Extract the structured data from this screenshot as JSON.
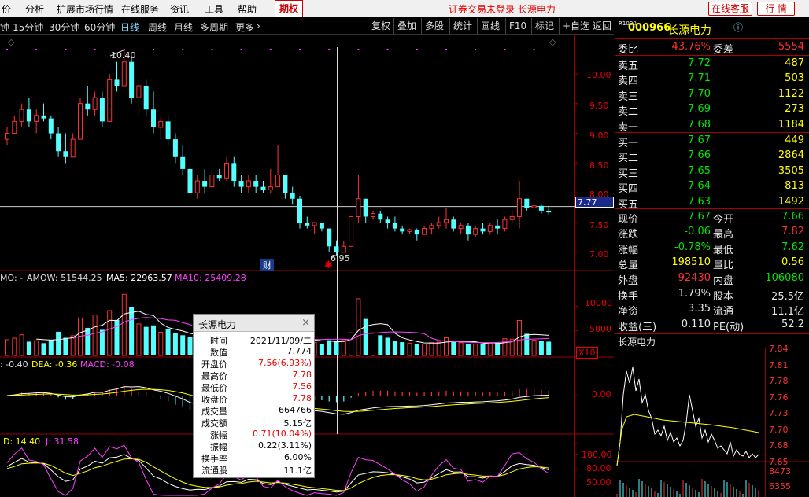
{
  "menubar": {
    "items": [
      "价",
      "分析",
      "扩展市场行情",
      "在线服务",
      "资讯",
      "工具",
      "帮助"
    ],
    "qq": "期权",
    "title": "证券交易未登录  长源电力",
    "btn_kefu": "在线客服",
    "btn_hangqing": "行 情"
  },
  "periods": [
    "钟",
    "15分钟",
    "30分钟",
    "60分钟",
    "日线",
    "周线",
    "月线",
    "多周期",
    "更多"
  ],
  "active_period": "日线",
  "toolbar": [
    "复权",
    "叠加",
    "多股",
    "统计",
    "画线",
    "F10",
    "标记",
    "+自选",
    "返回"
  ],
  "price_axis": [
    "10.00",
    "9.50",
    "9.00",
    "8.50",
    "8.00",
    "7.50",
    "7.00"
  ],
  "last_price_tag": "7.77",
  "high_mark": "10.40",
  "low_mark": "6.95",
  "cai_marker": "财",
  "vol_header": {
    "prefix": "MO: -",
    "amow_label": "AMOW: 51544.25",
    "ma5_label": "MA5: 22963.57",
    "ma10_label": "MA10: 25409.28"
  },
  "vol_axis": [
    "10000",
    "5000"
  ],
  "vol_multiplier": "X10",
  "macd_header": {
    "diff": ": -0.40",
    "dea": "DEA: -0.36",
    "macd": "MACD: -0.08"
  },
  "macd_axis": [
    "0.00"
  ],
  "kdj_header": {
    "d": "D: 14.40",
    "j": "J: 31.58"
  },
  "kdj_axis": [
    "100.00",
    "80.00",
    "50.00"
  ],
  "chart_data": {
    "type": "candlestick",
    "ylim": [
      6.8,
      10.5
    ],
    "vlim": [
      0,
      15000
    ],
    "ohlc": [
      [
        8.9,
        9.1,
        8.8,
        9.0
      ],
      [
        9.0,
        9.3,
        9.0,
        9.2
      ],
      [
        9.2,
        9.5,
        9.1,
        9.4
      ],
      [
        9.4,
        9.6,
        9.1,
        9.2
      ],
      [
        9.2,
        9.4,
        9.0,
        9.3
      ],
      [
        9.3,
        9.5,
        9.2,
        9.25
      ],
      [
        9.25,
        9.3,
        8.9,
        9.0
      ],
      [
        9.0,
        9.1,
        8.6,
        8.7
      ],
      [
        8.7,
        9.0,
        8.5,
        8.6
      ],
      [
        8.6,
        9.0,
        8.6,
        8.9
      ],
      [
        8.9,
        9.6,
        8.9,
        9.5
      ],
      [
        9.5,
        9.8,
        9.3,
        9.4
      ],
      [
        9.4,
        9.7,
        9.3,
        9.6
      ],
      [
        9.6,
        9.7,
        9.1,
        9.2
      ],
      [
        9.2,
        10.0,
        9.2,
        9.9
      ],
      [
        9.9,
        10.2,
        9.7,
        9.8
      ],
      [
        9.8,
        10.4,
        9.8,
        10.2
      ],
      [
        10.2,
        10.3,
        9.5,
        9.6
      ],
      [
        9.6,
        9.9,
        9.3,
        9.8
      ],
      [
        9.8,
        9.9,
        9.3,
        9.4
      ],
      [
        9.4,
        9.7,
        9.0,
        9.1
      ],
      [
        9.1,
        9.3,
        8.9,
        9.2
      ],
      [
        9.2,
        9.3,
        8.8,
        8.9
      ],
      [
        8.9,
        9.0,
        8.5,
        8.6
      ],
      [
        8.6,
        8.8,
        8.3,
        8.4
      ],
      [
        8.4,
        8.5,
        7.9,
        8.0
      ],
      [
        8.0,
        8.3,
        7.9,
        8.2
      ],
      [
        8.2,
        8.4,
        8.0,
        8.1
      ],
      [
        8.1,
        8.4,
        8.1,
        8.3
      ],
      [
        8.3,
        8.4,
        8.2,
        8.25
      ],
      [
        8.25,
        8.6,
        8.2,
        8.5
      ],
      [
        8.5,
        8.6,
        8.1,
        8.2
      ],
      [
        8.2,
        8.3,
        8.0,
        8.1
      ],
      [
        8.1,
        8.3,
        8.0,
        8.2
      ],
      [
        8.2,
        8.3,
        8.0,
        8.1
      ],
      [
        8.1,
        8.2,
        8.0,
        8.05
      ],
      [
        8.05,
        8.4,
        8.0,
        8.1
      ],
      [
        8.1,
        8.8,
        8.1,
        8.3
      ],
      [
        8.3,
        8.3,
        7.9,
        8.0
      ],
      [
        8.0,
        8.1,
        7.8,
        7.9
      ],
      [
        7.9,
        7.95,
        7.4,
        7.5
      ],
      [
        7.5,
        7.6,
        7.4,
        7.45
      ],
      [
        7.45,
        7.5,
        7.3,
        7.5
      ],
      [
        7.5,
        7.5,
        7.35,
        7.4
      ],
      [
        7.4,
        7.4,
        7.0,
        7.1
      ],
      [
        7.1,
        7.2,
        6.95,
        7.0
      ],
      [
        7.0,
        7.2,
        7.0,
        7.1
      ],
      [
        7.1,
        7.6,
        7.1,
        7.6
      ],
      [
        7.6,
        8.3,
        7.5,
        7.9
      ],
      [
        7.9,
        7.9,
        7.5,
        7.6
      ],
      [
        7.6,
        7.7,
        7.55,
        7.65
      ],
      [
        7.65,
        7.7,
        7.5,
        7.55
      ],
      [
        7.55,
        7.6,
        7.4,
        7.5
      ],
      [
        7.5,
        7.6,
        7.35,
        7.4
      ],
      [
        7.4,
        7.45,
        7.3,
        7.35
      ],
      [
        7.35,
        7.4,
        7.3,
        7.38
      ],
      [
        7.38,
        7.4,
        7.2,
        7.3
      ],
      [
        7.3,
        7.45,
        7.3,
        7.4
      ],
      [
        7.4,
        7.5,
        7.3,
        7.45
      ],
      [
        7.45,
        7.6,
        7.4,
        7.5
      ],
      [
        7.5,
        7.75,
        7.4,
        7.55
      ],
      [
        7.55,
        7.6,
        7.35,
        7.4
      ],
      [
        7.4,
        7.5,
        7.3,
        7.45
      ],
      [
        7.45,
        7.5,
        7.2,
        7.3
      ],
      [
        7.3,
        7.45,
        7.25,
        7.4
      ],
      [
        7.4,
        7.5,
        7.3,
        7.35
      ],
      [
        7.35,
        7.5,
        7.3,
        7.45
      ],
      [
        7.45,
        7.55,
        7.3,
        7.4
      ],
      [
        7.4,
        7.6,
        7.35,
        7.55
      ],
      [
        7.55,
        7.7,
        7.5,
        7.6
      ],
      [
        7.6,
        8.2,
        7.4,
        7.9
      ],
      [
        7.9,
        7.9,
        7.7,
        7.75
      ],
      [
        7.75,
        7.8,
        7.7,
        7.78
      ],
      [
        7.78,
        7.8,
        7.65,
        7.7
      ],
      [
        7.7,
        7.78,
        7.62,
        7.67
      ]
    ],
    "volume": [
      3200,
      3500,
      4200,
      2800,
      3000,
      2500,
      3100,
      4800,
      3600,
      4000,
      7600,
      5600,
      8200,
      5200,
      9100,
      7200,
      12400,
      9800,
      6400,
      5800,
      6100,
      4700,
      5300,
      4600,
      4100,
      3700,
      3400,
      3300,
      2900,
      3000,
      3500,
      3100,
      2800,
      2700,
      2500,
      2600,
      3200,
      5800,
      3300,
      3100,
      3800,
      2900,
      2600,
      2400,
      3100,
      2900,
      3200,
      4600,
      11500,
      7400,
      4600,
      4100,
      3600,
      2900,
      2700,
      2500,
      2400,
      2300,
      2600,
      2700,
      3600,
      3000,
      2600,
      2400,
      2300,
      2300,
      2400,
      2600,
      3400,
      3300,
      7100,
      4400,
      3100,
      3000,
      2800
    ]
  },
  "quote": {
    "code": "000966",
    "name": "长源电力",
    "badge": "R1000",
    "info": "ⓘ",
    "weibi_k": "委比",
    "weibi_v": "43.76%",
    "weicha_k": "委差",
    "weicha_v": "5554",
    "asks": [
      {
        "k": "卖五",
        "p": "7.72",
        "v": "487"
      },
      {
        "k": "卖四",
        "p": "7.71",
        "v": "503"
      },
      {
        "k": "卖三",
        "p": "7.70",
        "v": "1122"
      },
      {
        "k": "卖二",
        "p": "7.69",
        "v": "273"
      },
      {
        "k": "卖一",
        "p": "7.68",
        "v": "1184"
      }
    ],
    "bids": [
      {
        "k": "买一",
        "p": "7.67",
        "v": "449"
      },
      {
        "k": "买二",
        "p": "7.66",
        "v": "2864"
      },
      {
        "k": "买三",
        "p": "7.65",
        "v": "3505"
      },
      {
        "k": "买四",
        "p": "7.64",
        "v": "813"
      },
      {
        "k": "买五",
        "p": "7.63",
        "v": "1492"
      }
    ],
    "stats": [
      {
        "k1": "现价",
        "v1": "7.67",
        "c1": "grn",
        "k2": "今开",
        "v2": "7.66",
        "c2": "grn"
      },
      {
        "k1": "涨跌",
        "v1": "-0.06",
        "c1": "grn",
        "k2": "最高",
        "v2": "7.82",
        "c2": "red"
      },
      {
        "k1": "涨幅",
        "v1": "-0.78%",
        "c1": "grn",
        "k2": "最低",
        "v2": "7.62",
        "c2": "grn"
      },
      {
        "k1": "总量",
        "v1": "198510",
        "c1": "yel",
        "k2": "量比",
        "v2": "0.56",
        "c2": "yel"
      },
      {
        "k1": "外盘",
        "v1": "92430",
        "c1": "red",
        "k2": "内盘",
        "v2": "106080",
        "c2": "grn"
      }
    ],
    "stats2": [
      {
        "k1": "换手",
        "v1": "1.79%",
        "k2": "股本",
        "v2": "25.5亿"
      },
      {
        "k1": "净资",
        "v1": "3.35",
        "k2": "流通",
        "v2": "11.1亿"
      },
      {
        "k1": "收益(三)",
        "v1": "0.110",
        "k2": "PE(动)",
        "v2": "52.2"
      }
    ],
    "mini_title": "长源电力",
    "mini_axis": [
      "7.84",
      "7.81",
      "7.78",
      "7.76",
      "7.73",
      "7.70",
      "7.68",
      "7.65"
    ],
    "mini_vol_axis": [
      "8473",
      "6355"
    ]
  },
  "popup": {
    "title": "长源电力",
    "close": "×",
    "rows": [
      {
        "k": "时间",
        "v": "2021/11/09/二",
        "c": "#000"
      },
      {
        "k": "数值",
        "v": "7.774",
        "c": "#000"
      },
      {
        "k": "开盘价",
        "v": "7.56(6.93%)",
        "c": "#e00"
      },
      {
        "k": "最高价",
        "v": "7.78",
        "c": "#e00"
      },
      {
        "k": "最低价",
        "v": "7.56",
        "c": "#e00"
      },
      {
        "k": "收盘价",
        "v": "7.78",
        "c": "#e00"
      },
      {
        "k": "成交量",
        "v": "664766",
        "c": "#000"
      },
      {
        "k": "成交额",
        "v": "5.15亿",
        "c": "#000"
      },
      {
        "k": "涨幅",
        "v": "0.71(10.04%)",
        "c": "#e00"
      },
      {
        "k": "振幅",
        "v": "0.22(3.11%)",
        "c": "#000"
      },
      {
        "k": "换手率",
        "v": "6.00%",
        "c": "#000"
      },
      {
        "k": "流通股",
        "v": "11.1亿",
        "c": "#000"
      }
    ]
  },
  "colors": {
    "up": "#ff3232",
    "down": "#54ffff",
    "ma5": "#ffffff",
    "ma10": "#ffff00",
    "ma20": "#ff40ff",
    "grid": "#a00000"
  }
}
